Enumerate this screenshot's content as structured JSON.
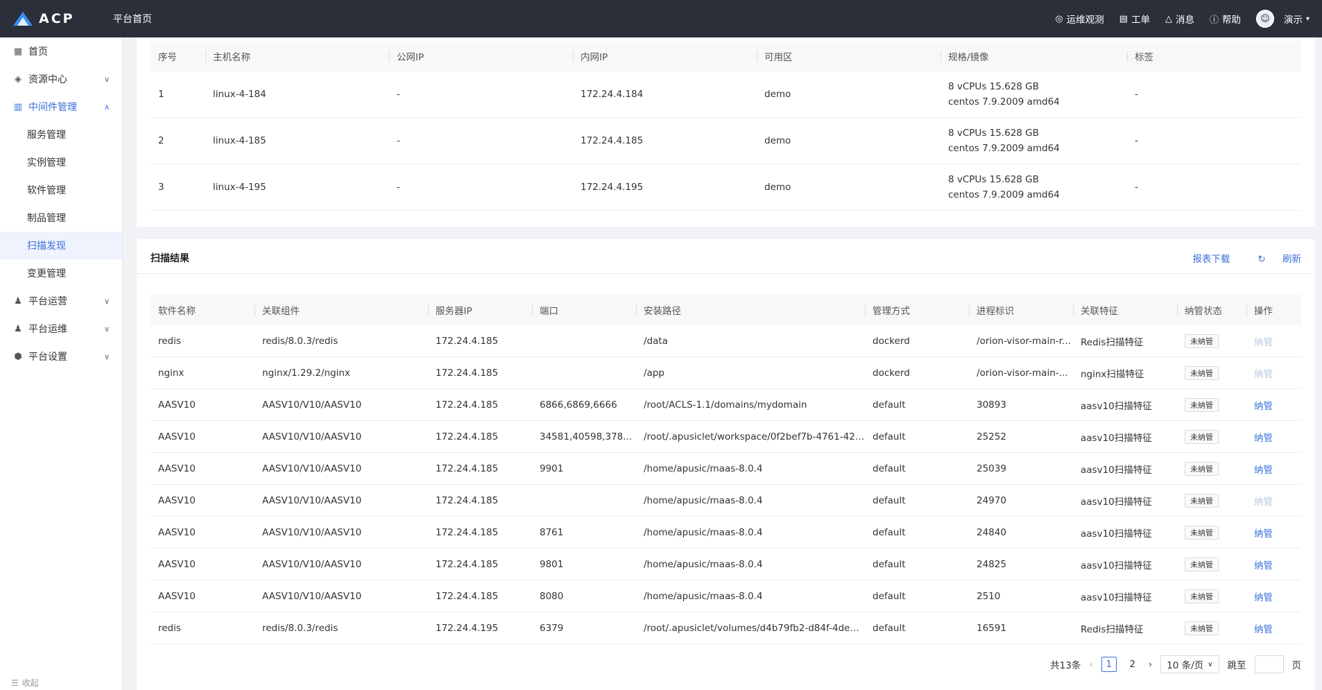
{
  "header": {
    "logo_text": "ACP",
    "home_label": "平台首页",
    "items": [
      {
        "icon": "location-icon",
        "glyph": "◎",
        "label": "运维观测"
      },
      {
        "icon": "ticket-icon",
        "glyph": "▤",
        "label": "工单"
      },
      {
        "icon": "bell-icon",
        "glyph": "♫",
        "label": "消息"
      },
      {
        "icon": "help-icon",
        "glyph": "?",
        "label": "帮助"
      }
    ],
    "user_name": "演示"
  },
  "sidebar": {
    "items": [
      {
        "label": "首页"
      },
      {
        "label": "资源中心"
      },
      {
        "label": "中间件管理"
      },
      {
        "label": "平台运营"
      },
      {
        "label": "平台运维"
      },
      {
        "label": "平台设置"
      }
    ],
    "sub_items": [
      {
        "label": "服务管理"
      },
      {
        "label": "实例管理"
      },
      {
        "label": "软件管理"
      },
      {
        "label": "制品管理"
      },
      {
        "label": "扫描发现"
      },
      {
        "label": "变更管理"
      }
    ],
    "collapse_label": "收起"
  },
  "hosts": {
    "columns": [
      "序号",
      "主机名称",
      "公网IP",
      "内网IP",
      "可用区",
      "规格/镜像",
      "标签"
    ],
    "rows": [
      {
        "no": "1",
        "name": "linux-4-184",
        "public_ip": "-",
        "private_ip": "172.24.4.184",
        "zone": "demo",
        "spec": "8 vCPUs 15.628 GB",
        "image": "centos 7.9.2009 amd64",
        "tag": "-"
      },
      {
        "no": "2",
        "name": "linux-4-185",
        "public_ip": "-",
        "private_ip": "172.24.4.185",
        "zone": "demo",
        "spec": "8 vCPUs 15.628 GB",
        "image": "centos 7.9.2009 amd64",
        "tag": "-"
      },
      {
        "no": "3",
        "name": "linux-4-195",
        "public_ip": "-",
        "private_ip": "172.24.4.195",
        "zone": "demo",
        "spec": "8 vCPUs 15.628 GB",
        "image": "centos 7.9.2009 amd64",
        "tag": "-"
      }
    ]
  },
  "scan": {
    "title": "扫描结果",
    "download_label": "报表下载",
    "refresh_label": "刷新",
    "columns": [
      "软件名称",
      "关联组件",
      "服务器IP",
      "端口",
      "安装路径",
      "管理方式",
      "进程标识",
      "关联特征",
      "纳管状态",
      "操作"
    ],
    "rows": [
      {
        "software": "redis",
        "component": "redis/8.0.3/redis",
        "ip": "172.24.4.185",
        "port": "",
        "path": "/data",
        "mode": "dockerd",
        "pid": "/orion-visor-main-r...",
        "feature": "Redis扫描特征",
        "status": "未纳管",
        "action": "纳管",
        "action_enabled": false
      },
      {
        "software": "nginx",
        "component": "nginx/1.29.2/nginx",
        "ip": "172.24.4.185",
        "port": "",
        "path": "/app",
        "mode": "dockerd",
        "pid": "/orion-visor-main-...",
        "feature": "nginx扫描特征",
        "status": "未纳管",
        "action": "纳管",
        "action_enabled": false
      },
      {
        "software": "AASV10",
        "component": "AASV10/V10/AASV10",
        "ip": "172.24.4.185",
        "port": "6866,6869,6666",
        "path": "/root/ACLS-1.1/domains/mydomain",
        "mode": "default",
        "pid": "30893",
        "feature": "aasv10扫描特征",
        "status": "未纳管",
        "action": "纳管",
        "action_enabled": true
      },
      {
        "software": "AASV10",
        "component": "AASV10/V10/AASV10",
        "ip": "172.24.4.185",
        "port": "34581,40598,378...",
        "path": "/root/.apusiclet/workspace/0f2bef7b-4761-4203...",
        "mode": "default",
        "pid": "25252",
        "feature": "aasv10扫描特征",
        "status": "未纳管",
        "action": "纳管",
        "action_enabled": true
      },
      {
        "software": "AASV10",
        "component": "AASV10/V10/AASV10",
        "ip": "172.24.4.185",
        "port": "9901",
        "path": "/home/apusic/maas-8.0.4",
        "mode": "default",
        "pid": "25039",
        "feature": "aasv10扫描特征",
        "status": "未纳管",
        "action": "纳管",
        "action_enabled": true
      },
      {
        "software": "AASV10",
        "component": "AASV10/V10/AASV10",
        "ip": "172.24.4.185",
        "port": "",
        "path": "/home/apusic/maas-8.0.4",
        "mode": "default",
        "pid": "24970",
        "feature": "aasv10扫描特征",
        "status": "未纳管",
        "action": "纳管",
        "action_enabled": false
      },
      {
        "software": "AASV10",
        "component": "AASV10/V10/AASV10",
        "ip": "172.24.4.185",
        "port": "8761",
        "path": "/home/apusic/maas-8.0.4",
        "mode": "default",
        "pid": "24840",
        "feature": "aasv10扫描特征",
        "status": "未纳管",
        "action": "纳管",
        "action_enabled": true
      },
      {
        "software": "AASV10",
        "component": "AASV10/V10/AASV10",
        "ip": "172.24.4.185",
        "port": "9801",
        "path": "/home/apusic/maas-8.0.4",
        "mode": "default",
        "pid": "24825",
        "feature": "aasv10扫描特征",
        "status": "未纳管",
        "action": "纳管",
        "action_enabled": true
      },
      {
        "software": "AASV10",
        "component": "AASV10/V10/AASV10",
        "ip": "172.24.4.185",
        "port": "8080",
        "path": "/home/apusic/maas-8.0.4",
        "mode": "default",
        "pid": "2510",
        "feature": "aasv10扫描特征",
        "status": "未纳管",
        "action": "纳管",
        "action_enabled": true
      },
      {
        "software": "redis",
        "component": "redis/8.0.3/redis",
        "ip": "172.24.4.195",
        "port": "6379",
        "path": "/root/.apusiclet/volumes/d4b79fb2-d84f-4deb-8...",
        "mode": "default",
        "pid": "16591",
        "feature": "Redis扫描特征",
        "status": "未纳管",
        "action": "纳管",
        "action_enabled": true
      }
    ]
  },
  "pagination": {
    "total": "共13条",
    "pages": [
      "1",
      "2"
    ],
    "current": "1",
    "page_size": "10 条/页",
    "jump_label": "跳至",
    "page_suffix": "页"
  },
  "colors": {
    "topbar": "#2b2f3a",
    "accent": "#3a6fd8"
  }
}
